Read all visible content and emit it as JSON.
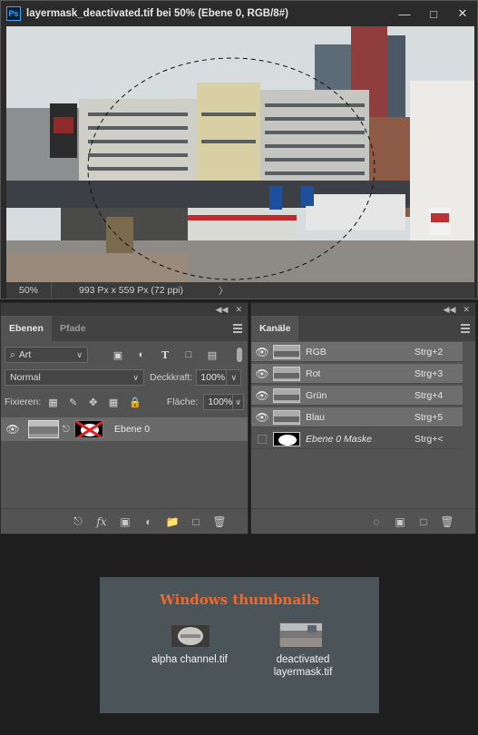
{
  "window": {
    "app_logo": "Ps",
    "title": "layermask_deactivated.tif bei 50% (Ebene 0, RGB/8#)",
    "minimize_glyph": "—",
    "maximize_glyph": "□",
    "close_glyph": "✕"
  },
  "status": {
    "zoom": "50%",
    "doc_size": "993 Px x 559 Px (72 ppi)",
    "arrow": "〉"
  },
  "layers_panel": {
    "tabs": [
      "Ebenen",
      "Pfade"
    ],
    "filter_label": "Art",
    "blend_mode": "Normal",
    "opacity_label": "Deckkraft:",
    "opacity_value": "100%",
    "lock_label": "Fixieren:",
    "fill_label": "Fläche:",
    "fill_value": "100%",
    "layer_name": "Ebene 0"
  },
  "channels_panel": {
    "tab": "Kanäle",
    "channels": [
      {
        "name": "RGB",
        "shortcut": "Strg+2"
      },
      {
        "name": "Rot",
        "shortcut": "Strg+3"
      },
      {
        "name": "Grün",
        "shortcut": "Strg+4"
      },
      {
        "name": "Blau",
        "shortcut": "Strg+5"
      },
      {
        "name": "Ebene 0 Maske",
        "shortcut": "Strg+<"
      }
    ]
  },
  "thumbnails": {
    "title": "Windows thumbnails",
    "item1_label": "alpha channel.tif",
    "item2_line1": "deactivated",
    "item2_line2": "layermask.tif"
  },
  "colors": {
    "accent_title": "#f06a2b",
    "ps_blue": "#31a8ff"
  },
  "icons": [
    "eye-icon",
    "link-icon",
    "fx-icon",
    "mask-icon",
    "adjustment-icon",
    "folder-icon",
    "new-layer-icon",
    "trash-icon",
    "lock-icon",
    "brush-icon",
    "move-icon"
  ]
}
